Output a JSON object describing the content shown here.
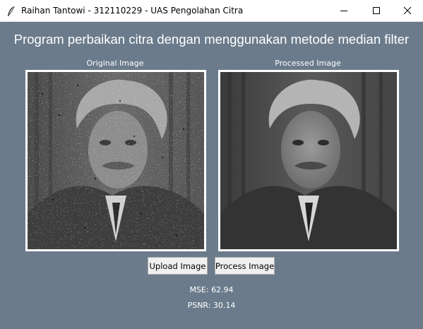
{
  "window": {
    "title": "Raihan Tantowi - 312110229 - UAS Pengolahan Citra",
    "controls": [
      "minimize-icon",
      "maximize-icon",
      "close-icon"
    ],
    "background": "#6b7b8c"
  },
  "heading": "Program perbaikan citra dengan menggunakan metode median filter",
  "original": {
    "label": "Original Image"
  },
  "processed": {
    "label": "Processed Image"
  },
  "buttons": {
    "upload": "Upload Image",
    "process": "Process Image"
  },
  "metrics": {
    "mse": "MSE: 62.94",
    "psnr": "PSNR: 30.14"
  }
}
